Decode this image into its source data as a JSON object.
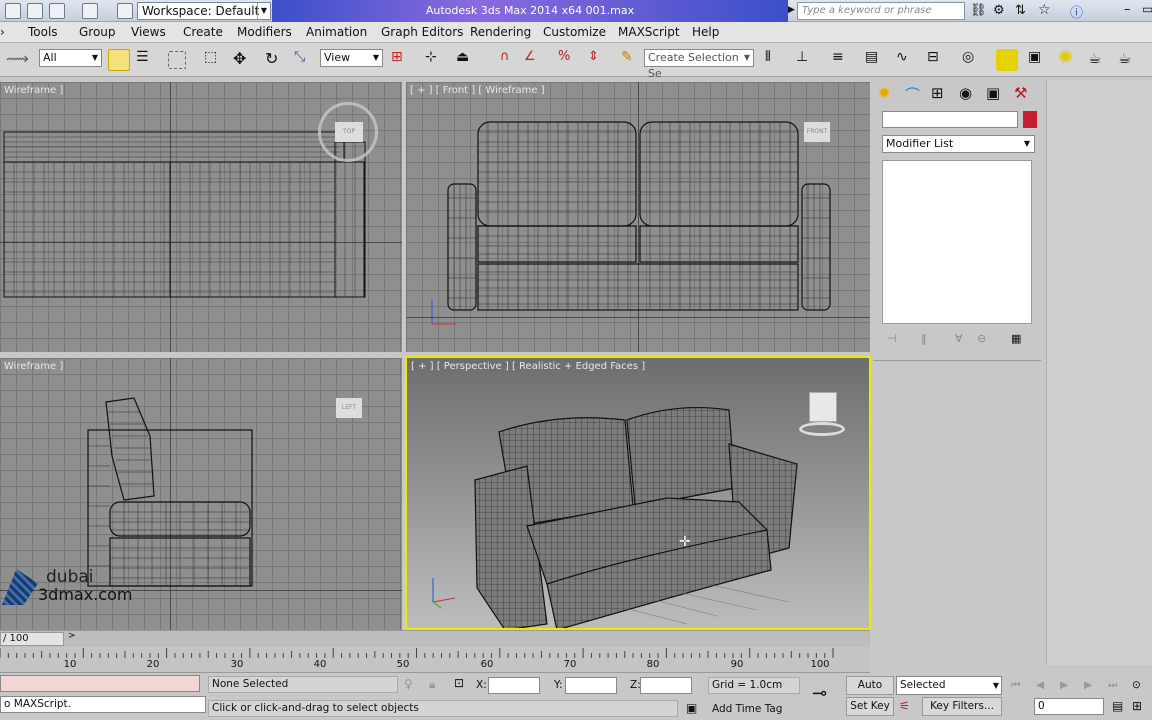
{
  "titlebar": {
    "workspace_label": "Workspace: Default",
    "app_title": "Autodesk 3ds Max  2014 x64       001.max",
    "search_placeholder": "Type a keyword or phrase"
  },
  "menu": [
    "Tools",
    "Group",
    "Views",
    "Create",
    "Modifiers",
    "Animation",
    "Graph Editors",
    "Rendering",
    "Customize",
    "MAXScript",
    "Help"
  ],
  "toolbar": {
    "filter_value": "All",
    "refcoord_value": "View",
    "selection_set_placeholder": "Create Selection Se"
  },
  "viewports": {
    "top": "Wireframe ]",
    "front": "[ + ] [ Front ] [ Wireframe ]",
    "left": "Wireframe ]",
    "perspective": "[ + ] [ Perspective ] [ Realistic + Edged Faces ]",
    "viewcube_top": "TOP",
    "viewcube_front": "FRONT",
    "viewcube_left": "LEFT"
  },
  "command_panel": {
    "modifier_list": "Modifier List"
  },
  "timeline": {
    "frame_counter": "/ 100",
    "ticks": [
      "10",
      "20",
      "30",
      "40",
      "50",
      "60",
      "70",
      "80",
      "90",
      "100"
    ]
  },
  "statusbar": {
    "maxscript": "o MAXScript.",
    "selection_status": "None Selected",
    "prompt": "Click or click-and-drag to select objects",
    "x_label": "X:",
    "y_label": "Y:",
    "z_label": "Z:",
    "grid": "Grid = 1.0cm",
    "add_time_tag": "Add Time Tag",
    "auto_key": "Auto Key",
    "set_key": "Set Key",
    "selected_value": "Selected",
    "key_filters": "Key Filters...",
    "frame_value": "0"
  },
  "watermark": {
    "line1": "dubai",
    "line2": "3dmax.com"
  },
  "colors": {
    "title_gradient": "#3b4fc9",
    "active_viewport_border": "#f0e800",
    "object_color": "#c42030"
  }
}
